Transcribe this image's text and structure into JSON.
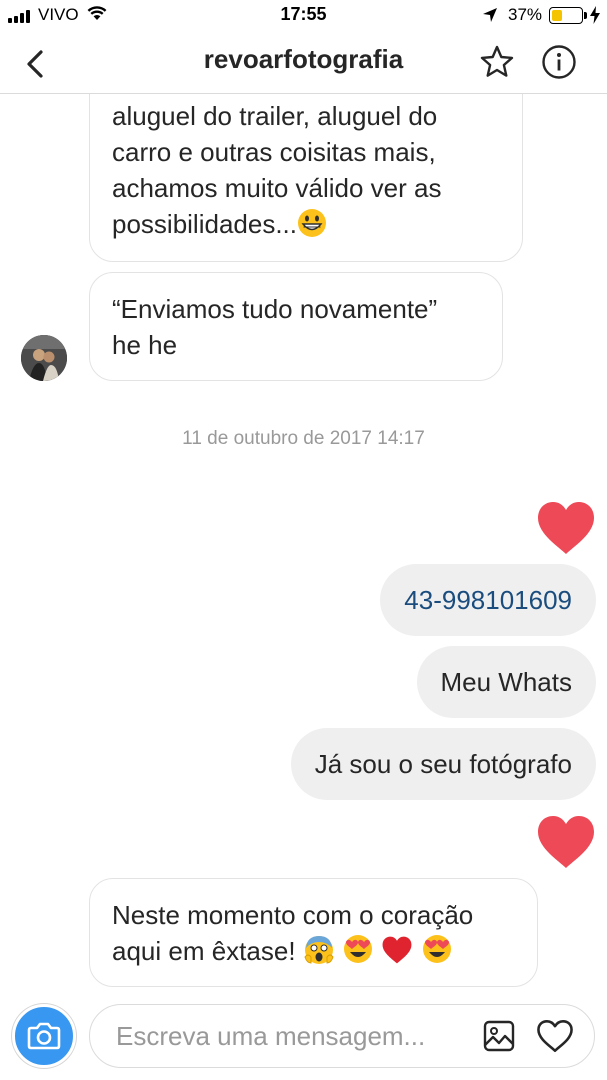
{
  "status_bar": {
    "carrier": "VIVO",
    "time": "17:55",
    "battery_percent": "37%",
    "battery_level": 0.37,
    "icons": [
      "signal-icon",
      "wifi-icon",
      "location-arrow-icon",
      "battery-icon",
      "charging-bolt-icon"
    ]
  },
  "header": {
    "title": "revoarfotografia",
    "icons": [
      "back-chevron-icon",
      "star-icon",
      "info-icon"
    ]
  },
  "messages": [
    {
      "direction": "incoming",
      "lines": [
        "aluguel do trailer, aluguel do",
        "carro e outras coisitas mais,",
        "achamos muito válido ver as",
        "possibilidades..."
      ],
      "emoji": [
        "grinning-face"
      ]
    },
    {
      "direction": "incoming",
      "lines": [
        "“Enviamos tudo novamente”",
        "he he"
      ]
    },
    {
      "direction": "incoming",
      "timestamp": "11 de outubro de 2017 14:17"
    },
    {
      "direction": "outgoing",
      "type": "like-heart"
    },
    {
      "direction": "outgoing",
      "text": "43-998101609",
      "link": true
    },
    {
      "direction": "outgoing",
      "text": "Meu Whats"
    },
    {
      "direction": "outgoing",
      "text": "Já sou o seu fotógrafo"
    },
    {
      "direction": "outgoing",
      "type": "like-heart"
    },
    {
      "direction": "incoming",
      "lines": [
        "Neste momento com o coração",
        "aqui em êxtase!"
      ],
      "emoji": [
        "face-screaming-in-fear",
        "heart-eyes",
        "red-heart",
        "heart-eyes"
      ]
    }
  ],
  "composer": {
    "placeholder": "Escreva uma mensagem...",
    "icons": [
      "camera-icon",
      "gallery-icon",
      "heart-outline-icon"
    ]
  },
  "colors": {
    "accent_blue": "#3897f0",
    "heart_red": "#ed4956",
    "link_text": "#1a4c7e",
    "outgoing_bubble": "#efefef",
    "timestamp": "#999999"
  }
}
